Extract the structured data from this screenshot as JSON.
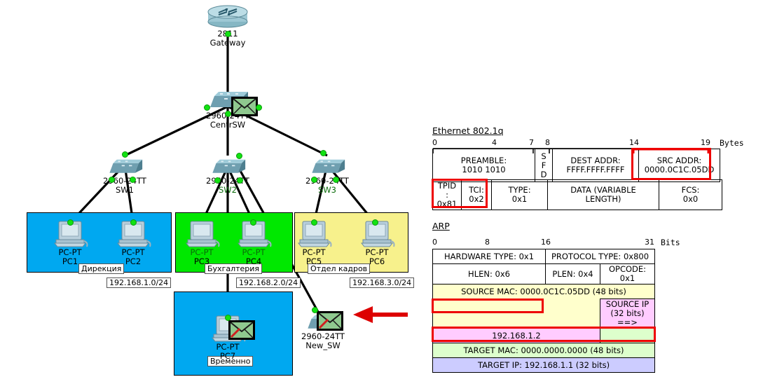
{
  "topology": {
    "nodes": [
      {
        "id": "gateway",
        "model": "2811",
        "name": "Gateway",
        "type": "router"
      },
      {
        "id": "centrsw",
        "model": "2960-24TT",
        "name": "CentrSW",
        "type": "switch",
        "envelope": "plain"
      },
      {
        "id": "sw1",
        "model": "2960-24TT",
        "name": "SW1",
        "type": "switch"
      },
      {
        "id": "sw2",
        "model": "2960-24TT",
        "name": "SW2",
        "type": "switch"
      },
      {
        "id": "sw3",
        "model": "2960-24TT",
        "name": "SW3",
        "type": "switch"
      },
      {
        "id": "pc1",
        "model": "PC-PT",
        "name": "PC1",
        "type": "pc"
      },
      {
        "id": "pc2",
        "model": "PC-PT",
        "name": "PC2",
        "type": "pc"
      },
      {
        "id": "pc3",
        "model": "PC-PT",
        "name": "PC3",
        "type": "pc"
      },
      {
        "id": "pc4",
        "model": "PC-PT",
        "name": "PC4",
        "type": "pc"
      },
      {
        "id": "pc5",
        "model": "PC-PT",
        "name": "PC5",
        "type": "pc"
      },
      {
        "id": "pc6",
        "model": "PC-PT",
        "name": "PC6",
        "type": "pc"
      },
      {
        "id": "pc7",
        "model": "PC-PT",
        "name": "PC7",
        "type": "pc",
        "envelope": "edited"
      },
      {
        "id": "newsw",
        "model": "2960-24TT",
        "name": "New_SW",
        "type": "switch",
        "envelope": "edited"
      }
    ],
    "zones": [
      {
        "id": "direkcia",
        "label": "Дирекция",
        "subnet": "192.168.1.0/24",
        "color": "#00a8f0"
      },
      {
        "id": "buhgalteria",
        "label": "Бухгалтерия",
        "subnet": "192.168.2.0/24",
        "color": "#00e800"
      },
      {
        "id": "otdel-kadrov",
        "label": "Отдел кадров",
        "subnet": "192.168.3.0/24",
        "color": "#f7f18c"
      },
      {
        "id": "vremenno",
        "label": "Временно",
        "subnet": "",
        "color": "#00a8f0"
      }
    ],
    "annotation_arrow": {
      "target": "newsw",
      "color": "#dd0000"
    }
  },
  "ethernet": {
    "title": "Ethernet 802.1q",
    "units": "Bytes",
    "ruler": [
      "0",
      "4",
      "7",
      "8",
      "14",
      "19"
    ],
    "row1": [
      {
        "id": "preamble",
        "line1": "PREAMBLE:",
        "line2": "1010 1010"
      },
      {
        "id": "sfd",
        "line1": "S",
        "line2": "F",
        "line3": "D"
      },
      {
        "id": "dest-addr",
        "line1": "DEST ADDR:",
        "line2": "FFFF.FFFF.FFFF"
      },
      {
        "id": "src-addr",
        "line1": "SRC ADDR:",
        "line2": "0000.0C1C.05DD",
        "highlight": true
      }
    ],
    "row2": [
      {
        "id": "tpid",
        "line1": "TPID",
        "line2": ":",
        "line3": "0x81",
        "highlight": true
      },
      {
        "id": "tci",
        "line1": "TCI:",
        "line2": "0x2",
        "highlight": true
      },
      {
        "id": "type",
        "line1": "TYPE:",
        "line2": "0x1"
      },
      {
        "id": "data",
        "line1": "DATA (VARIABLE",
        "line2": "LENGTH)"
      },
      {
        "id": "fcs",
        "line1": "FCS:",
        "line2": "0x0"
      }
    ]
  },
  "arp": {
    "title": "ARP",
    "units": "Bits",
    "ruler": [
      "0",
      "8",
      "16",
      "31"
    ],
    "rows": [
      {
        "id": "hw-proto",
        "cells": [
          {
            "id": "hardware-type",
            "text": "HARDWARE TYPE: 0x1",
            "bg": "#ffffff"
          },
          {
            "id": "protocol-type",
            "text": "PROTOCOL TYPE: 0x800",
            "bg": "#ffffff"
          }
        ]
      },
      {
        "id": "hlen-plen-opcode",
        "cells": [
          {
            "id": "hlen",
            "text": "HLEN: 0x6",
            "bg": "#ffffff"
          },
          {
            "id": "plen",
            "text": "PLEN: 0x4",
            "bg": "#ffffff"
          },
          {
            "id": "opcode",
            "text": "OPCODE: 0x1",
            "bg": "#ffffff"
          }
        ]
      },
      {
        "id": "source-mac",
        "cells": [
          {
            "id": "source-mac-cell",
            "text": "SOURCE MAC: 0000.0C1C.05DD (48 bits)",
            "bg": "#ffffcc"
          }
        ]
      },
      {
        "id": "source-ip-label",
        "cells": [
          {
            "id": "blank-yellow",
            "text": "",
            "bg": "#ffffcc"
          },
          {
            "id": "source-ip-cell",
            "text": "SOURCE IP (32 bits) ==>",
            "bg": "#ffccff"
          }
        ]
      },
      {
        "id": "source-ip-value",
        "cells": [
          {
            "id": "source-ip-value-cell",
            "text": "192.168.1.2",
            "bg": "#ffccff",
            "highlight": true
          },
          {
            "id": "blank-green",
            "text": "",
            "bg": "#ddffcc"
          }
        ]
      },
      {
        "id": "target-mac",
        "cells": [
          {
            "id": "target-mac-cell",
            "text": "TARGET MAC: 0000.0000.0000 (48 bits)",
            "bg": "#ddffcc"
          }
        ]
      },
      {
        "id": "target-ip",
        "cells": [
          {
            "id": "target-ip-cell",
            "text": "TARGET IP: 192.168.1.1 (32 bits)",
            "bg": "#ccccff",
            "highlight": true
          }
        ]
      }
    ]
  }
}
